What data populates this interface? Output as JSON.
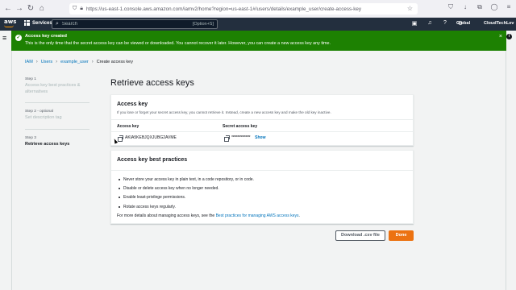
{
  "browser": {
    "url": "https://us-east-1.console.aws.amazon.com/iamv2/home?region=us-east-1#/users/details/example_user/create-access-key"
  },
  "aws_nav": {
    "logo": "aws",
    "services_label": "Services",
    "search_placeholder": "Search",
    "search_shortcut": "[Option+S]",
    "region": "Global",
    "account": "CloudTechLev"
  },
  "flash": {
    "title": "Access key created",
    "message": "This is the only time that the secret access key can be viewed or downloaded. You cannot recover it later. However, you can create a new access key any time."
  },
  "breadcrumb": [
    "IAM",
    "Users",
    "example_user",
    "Create access key"
  ],
  "steps": [
    {
      "num": "Step 1",
      "name": "Access key best practices & alternatives",
      "active": false
    },
    {
      "num": "Step 2 - optional",
      "name": "Set description tag",
      "active": false
    },
    {
      "num": "Step 3",
      "name": "Retrieve access keys",
      "active": true
    }
  ],
  "main": {
    "title": "Retrieve access keys",
    "access_key_panel": {
      "title": "Access key",
      "description": "If you lose or forget your secret access key, you cannot retrieve it. Instead, create a new access key and make the old key inactive.",
      "col_access_key": "Access key",
      "col_secret": "Secret access key",
      "access_key_value": "AKIA5KEBJQXJUBG2AVME",
      "secret_value": "****************",
      "show_label": "Show"
    },
    "best_practices": {
      "title": "Access key best practices",
      "items": [
        "Never store your access key in plain text, in a code repository, or in code.",
        "Disable or delete access key when no longer needed.",
        "Enable least-privilege permissions.",
        "Rotate access keys regularly."
      ],
      "more_prefix": "For more details about managing access keys, see the ",
      "more_link": "Best practices for managing AWS access keys",
      "more_suffix": "."
    }
  },
  "footer": {
    "download_label": "Download .csv file",
    "done_label": "Done"
  },
  "colors": {
    "aws_nav_bg": "#232f3e",
    "flash_green": "#1d8102",
    "link_blue": "#0073bb",
    "primary_orange": "#ec7211"
  }
}
